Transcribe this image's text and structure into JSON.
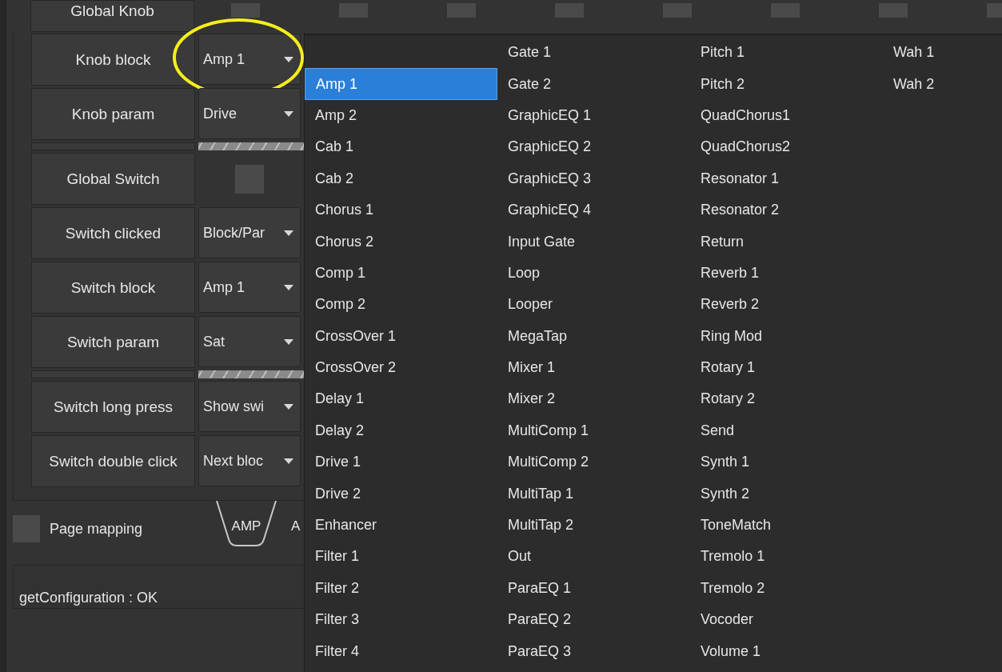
{
  "top_row": {
    "label": "Global Knob",
    "toggles": [
      {
        "checked": false
      },
      {
        "checked": false
      },
      {
        "checked": false
      },
      {
        "checked": false
      },
      {
        "checked": false
      },
      {
        "checked": false
      },
      {
        "checked": false
      },
      {
        "checked": false
      }
    ]
  },
  "settings": [
    {
      "kind": "dropdown",
      "label": "Knob block",
      "value": "Amp 1",
      "highlighted": true
    },
    {
      "kind": "dropdown",
      "label": "Knob param",
      "value": "Drive",
      "highlighted": false
    },
    {
      "kind": "separator"
    },
    {
      "kind": "checkbox",
      "label": "Global Switch",
      "checked": false
    },
    {
      "kind": "dropdown",
      "label": "Switch clicked",
      "value": "Block/Par",
      "highlighted": false
    },
    {
      "kind": "dropdown",
      "label": "Switch block",
      "value": "Amp 1",
      "highlighted": false
    },
    {
      "kind": "dropdown",
      "label": "Switch param",
      "value": "Sat",
      "highlighted": false
    },
    {
      "kind": "separator"
    },
    {
      "kind": "dropdown",
      "label": "Switch long press",
      "value": "Show swi",
      "highlighted": false
    },
    {
      "kind": "dropdown",
      "label": "Switch double click",
      "value": "Next bloc",
      "highlighted": false
    }
  ],
  "page_mapping": {
    "label": "Page mapping",
    "checked": false
  },
  "tabs": [
    {
      "label": "AMP",
      "selected": true
    },
    {
      "label": "A",
      "selected": false
    }
  ],
  "status": "getConfiguration : OK",
  "dropdown_menu": {
    "columns": [
      [
        {
          "label": "Amp 1",
          "selected": true
        },
        {
          "label": "Amp 2",
          "selected": false
        },
        {
          "label": "Cab 1",
          "selected": false
        },
        {
          "label": "Cab 2",
          "selected": false
        },
        {
          "label": "Chorus 1",
          "selected": false
        },
        {
          "label": "Chorus 2",
          "selected": false
        },
        {
          "label": "Comp 1",
          "selected": false
        },
        {
          "label": "Comp 2",
          "selected": false
        },
        {
          "label": "CrossOver 1",
          "selected": false
        },
        {
          "label": "CrossOver 2",
          "selected": false
        },
        {
          "label": "Delay 1",
          "selected": false
        },
        {
          "label": "Delay 2",
          "selected": false
        },
        {
          "label": "Drive 1",
          "selected": false
        },
        {
          "label": "Drive 2",
          "selected": false
        },
        {
          "label": "Enhancer",
          "selected": false
        },
        {
          "label": "Filter 1",
          "selected": false
        },
        {
          "label": "Filter 2",
          "selected": false
        },
        {
          "label": "Filter 3",
          "selected": false
        },
        {
          "label": "Filter 4",
          "selected": false
        }
      ],
      [
        {
          "label": "Gate 1",
          "selected": false
        },
        {
          "label": "Gate 2",
          "selected": false
        },
        {
          "label": "GraphicEQ 1",
          "selected": false
        },
        {
          "label": "GraphicEQ 2",
          "selected": false
        },
        {
          "label": "GraphicEQ 3",
          "selected": false
        },
        {
          "label": "GraphicEQ 4",
          "selected": false
        },
        {
          "label": "Input Gate",
          "selected": false
        },
        {
          "label": "Loop",
          "selected": false
        },
        {
          "label": "Looper",
          "selected": false
        },
        {
          "label": "MegaTap",
          "selected": false
        },
        {
          "label": "Mixer 1",
          "selected": false
        },
        {
          "label": "Mixer 2",
          "selected": false
        },
        {
          "label": "MultiComp 1",
          "selected": false
        },
        {
          "label": "MultiComp 2",
          "selected": false
        },
        {
          "label": "MultiTap 1",
          "selected": false
        },
        {
          "label": "MultiTap 2",
          "selected": false
        },
        {
          "label": "Out",
          "selected": false
        },
        {
          "label": "ParaEQ 1",
          "selected": false
        },
        {
          "label": "ParaEQ 2",
          "selected": false
        },
        {
          "label": "ParaEQ 3",
          "selected": false
        }
      ],
      [
        {
          "label": "Pitch 1",
          "selected": false
        },
        {
          "label": "Pitch 2",
          "selected": false
        },
        {
          "label": "QuadChorus1",
          "selected": false
        },
        {
          "label": "QuadChorus2",
          "selected": false
        },
        {
          "label": "Resonator 1",
          "selected": false
        },
        {
          "label": "Resonator 2",
          "selected": false
        },
        {
          "label": "Return",
          "selected": false
        },
        {
          "label": "Reverb 1",
          "selected": false
        },
        {
          "label": "Reverb 2",
          "selected": false
        },
        {
          "label": "Ring Mod",
          "selected": false
        },
        {
          "label": "Rotary 1",
          "selected": false
        },
        {
          "label": "Rotary 2",
          "selected": false
        },
        {
          "label": "Send",
          "selected": false
        },
        {
          "label": "Synth 1",
          "selected": false
        },
        {
          "label": "Synth 2",
          "selected": false
        },
        {
          "label": "ToneMatch",
          "selected": false
        },
        {
          "label": "Tremolo 1",
          "selected": false
        },
        {
          "label": "Tremolo 2",
          "selected": false
        },
        {
          "label": "Vocoder",
          "selected": false
        },
        {
          "label": "Volume 1",
          "selected": false
        }
      ],
      [
        {
          "label": "Wah 1",
          "selected": false
        },
        {
          "label": "Wah 2",
          "selected": false
        }
      ]
    ]
  }
}
